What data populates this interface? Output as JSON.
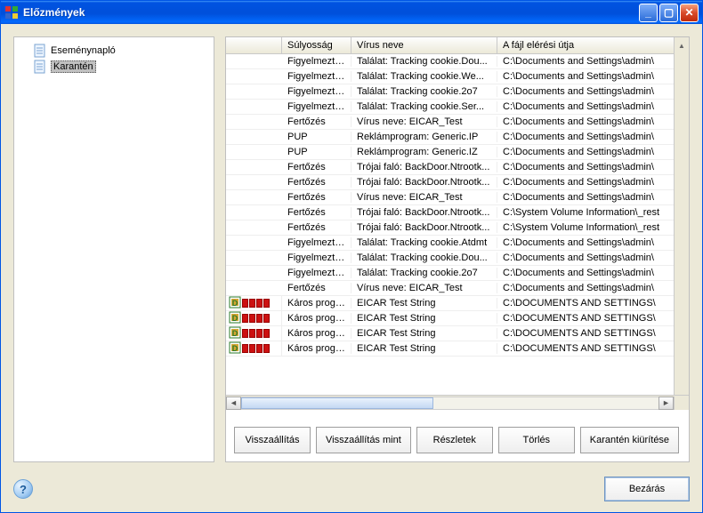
{
  "window": {
    "title": "Előzmények"
  },
  "sidebar": {
    "items": [
      {
        "label": "Eseménynapló"
      },
      {
        "label": "Karantén"
      }
    ],
    "selected_index": 1
  },
  "columns": {
    "icon": "",
    "severity": "Súlyosság",
    "virus_name": "Vírus neve",
    "file_path": "A fájl elérési útja"
  },
  "rows": [
    {
      "severity": "Figyelmeztetés",
      "name": "Találat: Tracking cookie.Dou...",
      "path": "C:\\Documents and Settings\\admin\\",
      "danger": false
    },
    {
      "severity": "Figyelmeztetés",
      "name": "Találat: Tracking cookie.We...",
      "path": "C:\\Documents and Settings\\admin\\",
      "danger": false
    },
    {
      "severity": "Figyelmeztetés",
      "name": "Találat: Tracking cookie.2o7",
      "path": "C:\\Documents and Settings\\admin\\",
      "danger": false
    },
    {
      "severity": "Figyelmeztetés",
      "name": "Találat: Tracking cookie.Ser...",
      "path": "C:\\Documents and Settings\\admin\\",
      "danger": false
    },
    {
      "severity": "Fertőzés",
      "name": "Vírus neve: EICAR_Test",
      "path": "C:\\Documents and Settings\\admin\\",
      "danger": false
    },
    {
      "severity": "PUP",
      "name": "Reklámprogram: Generic.IP",
      "path": "C:\\Documents and Settings\\admin\\",
      "danger": false
    },
    {
      "severity": "PUP",
      "name": "Reklámprogram: Generic.IZ",
      "path": "C:\\Documents and Settings\\admin\\",
      "danger": false
    },
    {
      "severity": "Fertőzés",
      "name": "Trójai faló: BackDoor.Ntrootk...",
      "path": "C:\\Documents and Settings\\admin\\",
      "danger": false
    },
    {
      "severity": "Fertőzés",
      "name": "Trójai faló: BackDoor.Ntrootk...",
      "path": "C:\\Documents and Settings\\admin\\",
      "danger": false
    },
    {
      "severity": "Fertőzés",
      "name": "Vírus neve: EICAR_Test",
      "path": "C:\\Documents and Settings\\admin\\",
      "danger": false
    },
    {
      "severity": "Fertőzés",
      "name": "Trójai faló: BackDoor.Ntrootk...",
      "path": "C:\\System Volume Information\\_rest",
      "danger": false
    },
    {
      "severity": "Fertőzés",
      "name": "Trójai faló: BackDoor.Ntrootk...",
      "path": "C:\\System Volume Information\\_rest",
      "danger": false
    },
    {
      "severity": "Figyelmeztetés",
      "name": "Találat: Tracking cookie.Atdmt",
      "path": "C:\\Documents and Settings\\admin\\",
      "danger": false
    },
    {
      "severity": "Figyelmeztetés",
      "name": "Találat: Tracking cookie.Dou...",
      "path": "C:\\Documents and Settings\\admin\\",
      "danger": false
    },
    {
      "severity": "Figyelmeztetés",
      "name": "Találat: Tracking cookie.2o7",
      "path": "C:\\Documents and Settings\\admin\\",
      "danger": false
    },
    {
      "severity": "Fertőzés",
      "name": "Vírus neve: EICAR_Test",
      "path": "C:\\Documents and Settings\\admin\\",
      "danger": false
    },
    {
      "severity": "Káros program",
      "name": "EICAR Test String",
      "path": "C:\\DOCUMENTS AND SETTINGS\\",
      "danger": true
    },
    {
      "severity": "Káros program",
      "name": "EICAR Test String",
      "path": "C:\\DOCUMENTS AND SETTINGS\\",
      "danger": true
    },
    {
      "severity": "Káros program",
      "name": "EICAR Test String",
      "path": "C:\\DOCUMENTS AND SETTINGS\\",
      "danger": true
    },
    {
      "severity": "Káros program",
      "name": "EICAR Test String",
      "path": "C:\\DOCUMENTS AND SETTINGS\\",
      "danger": true
    }
  ],
  "buttons": {
    "restore": "Visszaállítás",
    "restore_as": "Visszaállítás mint",
    "details": "Részletek",
    "delete": "Törlés",
    "empty_quarantine": "Karantén kiürítése"
  },
  "footer": {
    "close": "Bezárás"
  }
}
